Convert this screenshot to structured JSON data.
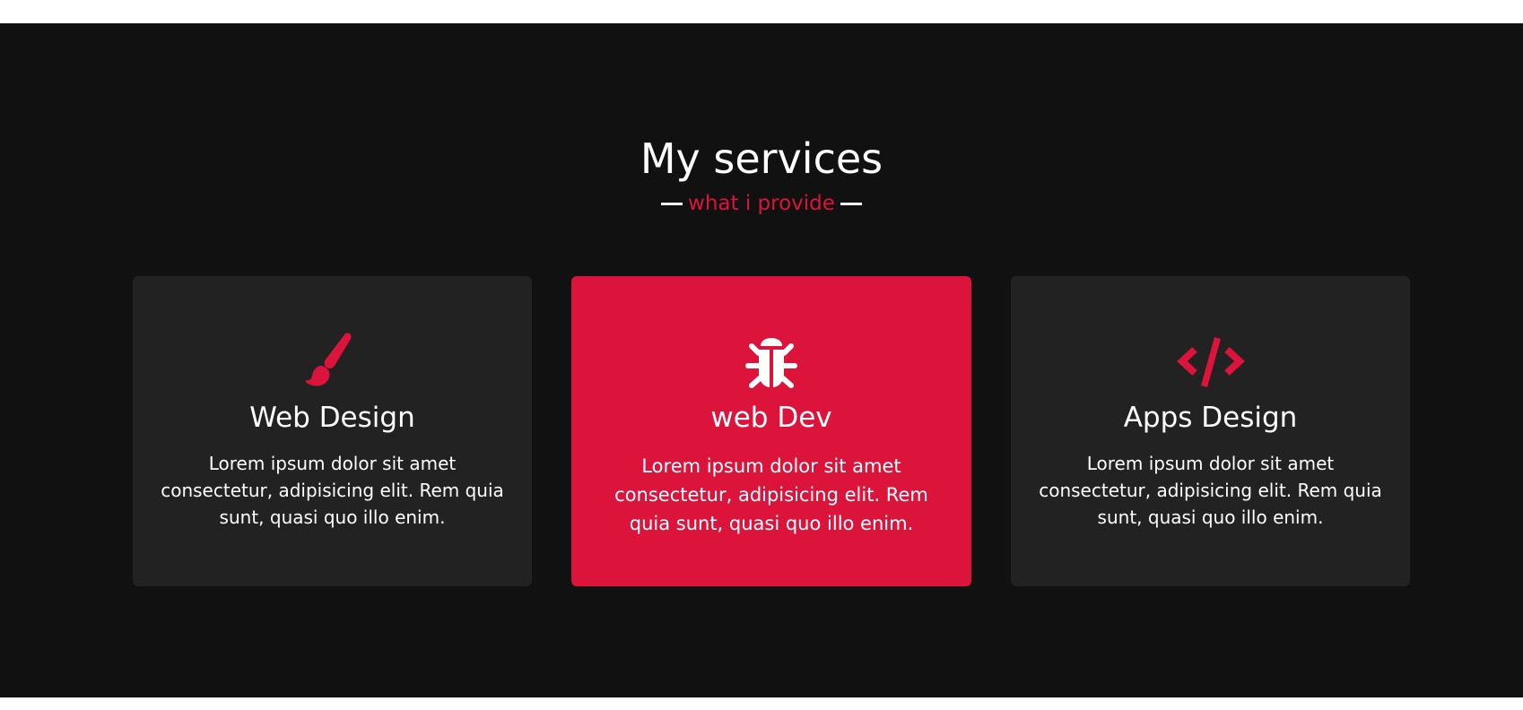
{
  "section": {
    "title": "My services",
    "subtitle": "what i provide"
  },
  "colors": {
    "background": "#111111",
    "card": "#222222",
    "accent": "#dc143c",
    "text": "#ffffff"
  },
  "cards": [
    {
      "icon": "paint-brush-icon",
      "title": "Web Design",
      "text": "Lorem ipsum dolor sit amet consectetur, adipisicing elit. Rem quia sunt, quasi quo illo enim."
    },
    {
      "icon": "bug-icon",
      "title": "web Dev",
      "text": "Lorem ipsum dolor sit amet consectetur, adipisicing elit. Rem quia sunt, quasi quo illo enim."
    },
    {
      "icon": "code-icon",
      "title": "Apps Design",
      "text": "Lorem ipsum dolor sit amet consectetur, adipisicing elit. Rem quia sunt, quasi quo illo enim."
    }
  ]
}
